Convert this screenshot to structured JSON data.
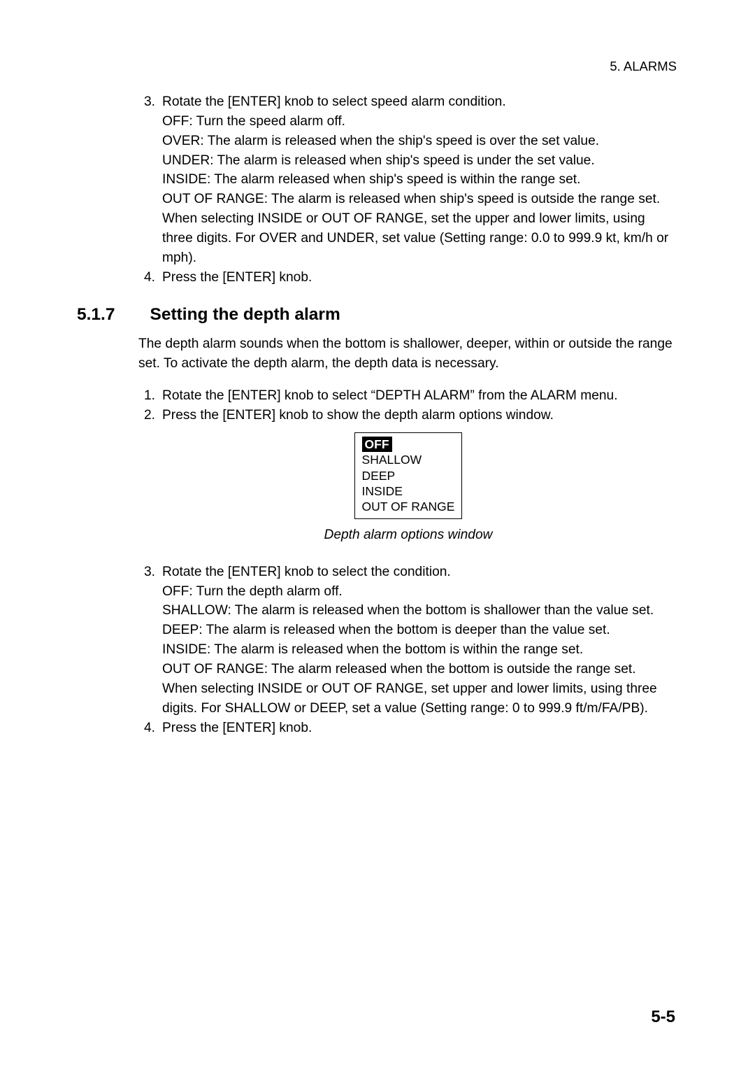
{
  "header": {
    "chapter": "5. ALARMS"
  },
  "topList": {
    "item3": {
      "num": "3.",
      "line1": "Rotate the [ENTER] knob to select speed alarm condition.",
      "off": "OFF: Turn the speed alarm off.",
      "over": "OVER: The alarm is released when the ship's speed is over the set value.",
      "under": "UNDER: The alarm is released when ship's speed is under the set value.",
      "inside": "INSIDE: The alarm released when ship's speed is within the range set.",
      "outof": "OUT OF RANGE: The alarm is released when ship's speed is outside the range set.",
      "note": "When selecting INSIDE or OUT OF RANGE, set the upper and lower limits, using three digits. For OVER and UNDER, set value (Setting range: 0.0 to 999.9 kt, km/h or mph)."
    },
    "item4": {
      "num": "4.",
      "text": "Press the [ENTER] knob."
    }
  },
  "section": {
    "num": "5.1.7",
    "title": "Setting the depth alarm"
  },
  "intro": "The depth alarm sounds when the bottom is shallower, deeper, within or outside the range set. To activate the depth alarm, the depth data is necessary.",
  "midList": {
    "item1": {
      "num": "1.",
      "text": "Rotate the [ENTER] knob to select “DEPTH ALARM” from the ALARM menu."
    },
    "item2": {
      "num": "2.",
      "text": "Press the [ENTER] knob to show the depth alarm options window."
    }
  },
  "options": {
    "selected": "OFF",
    "o1": "SHALLOW",
    "o2": "DEEP",
    "o3": "INSIDE",
    "o4": "OUT OF RANGE"
  },
  "figureCaption": "Depth alarm options window",
  "bottomList": {
    "item3": {
      "num": "3.",
      "line1": "Rotate the [ENTER] knob to select the condition.",
      "off": "OFF: Turn the depth alarm off.",
      "shallow": "SHALLOW: The alarm is released when the bottom is shallower than the value set.",
      "deep": "DEEP: The alarm is released when the bottom is deeper than the value set.",
      "inside": "INSIDE: The alarm is released when the bottom is within the range set.",
      "outof": "OUT OF RANGE: The alarm released when the bottom is outside the range set.",
      "note": "When selecting INSIDE or OUT OF RANGE, set upper and lower limits, using three digits. For SHALLOW or DEEP, set a value (Setting range: 0 to 999.9 ft/m/FA/PB)."
    },
    "item4": {
      "num": "4.",
      "text": "Press the [ENTER] knob."
    }
  },
  "pageNum": "5-5"
}
